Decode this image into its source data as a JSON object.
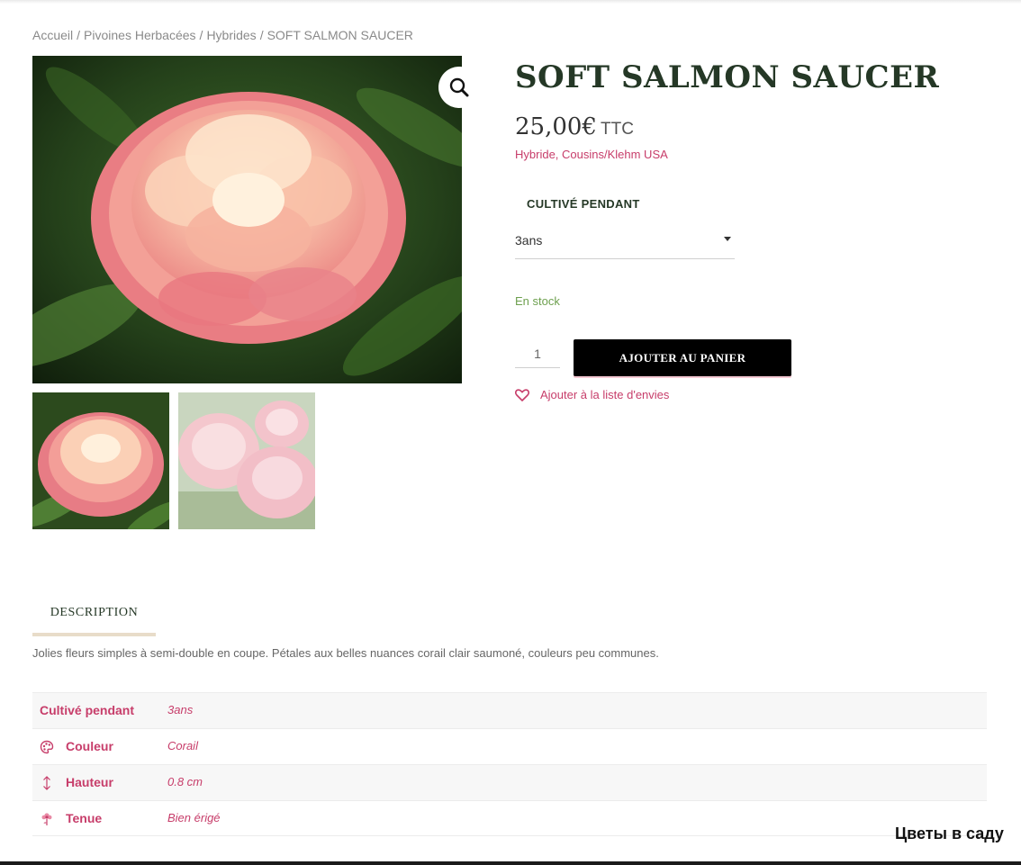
{
  "breadcrumb": {
    "items": [
      "Accueil",
      "Pivoines Herbacées",
      "Hybrides"
    ],
    "current": "SOFT SALMON SAUCER",
    "separator": "/"
  },
  "gallery": {
    "zoom_icon": "magnifier-icon",
    "thumbnails": [
      "peony-coral-thumbnail",
      "peony-pale-pink-thumbnail"
    ]
  },
  "product": {
    "title": "SOFT SALMON SAUCER",
    "price": "25,00€",
    "tax_label": "TTC",
    "subtitle": "Hybride, Cousins/Klehm USA",
    "variation_label": "CULTIVÉ PENDANT",
    "variation_selected": "3ans",
    "stock": "En stock",
    "quantity": "1",
    "add_to_cart": "AJOUTER AU PANIER",
    "wishlist": "Ajouter à la liste d'envies"
  },
  "tabs": [
    {
      "label": "DESCRIPTION",
      "active": true
    }
  ],
  "description": "Jolies fleurs simples à semi-double en coupe. Pétales aux belles nuances corail clair saumoné, couleurs peu communes.",
  "attributes": [
    {
      "name": "Cultivé pendant",
      "value": "3ans",
      "icon": ""
    },
    {
      "name": "Couleur",
      "value": "Corail",
      "icon": "palette-icon"
    },
    {
      "name": "Hauteur",
      "value": "0.8 cm",
      "icon": "vertical-arrows-icon"
    },
    {
      "name": "Tenue",
      "value": "Bien érigé",
      "icon": "flower-icon"
    }
  ],
  "watermark": "Цветы в саду",
  "colors": {
    "accent_pink": "#c73d6a",
    "title_green": "#253826",
    "stock_green": "#6ea04f",
    "button_black": "#000000",
    "tab_underline": "#e8dcc9"
  }
}
